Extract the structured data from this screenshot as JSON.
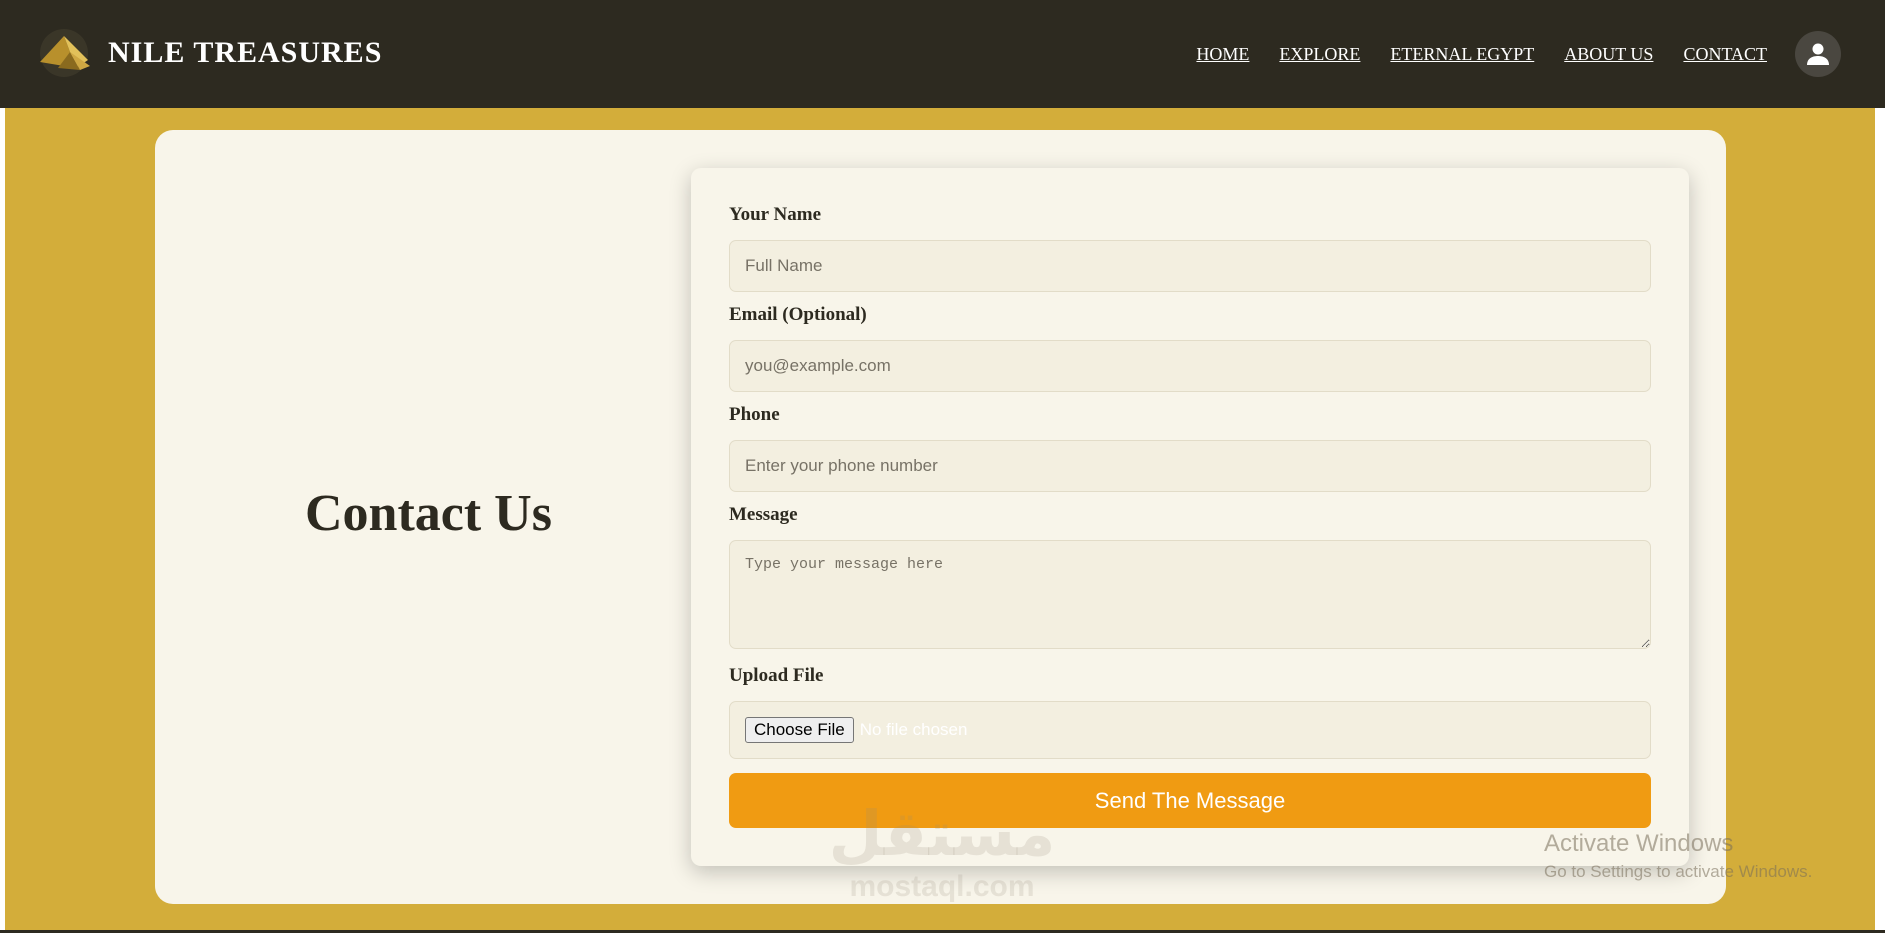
{
  "brand": {
    "title": "NILE TREASURES",
    "logo_icon": "pyramid-logo-icon"
  },
  "nav": {
    "links": [
      "HOME",
      "EXPLORE",
      "ETERNAL EGYPT",
      "ABOUT US",
      "CONTACT"
    ],
    "user_icon": "user-icon"
  },
  "page": {
    "heading": "Contact Us"
  },
  "form": {
    "name_label": "Your Name",
    "name_placeholder": "Full Name",
    "email_label": "Email (Optional)",
    "email_placeholder": "you@example.com",
    "phone_label": "Phone",
    "phone_placeholder": "Enter your phone number",
    "message_label": "Message",
    "message_placeholder": "Type your message here",
    "file_label": "Upload File",
    "file_button": "Choose File",
    "file_status": "No file chosen",
    "submit_label": "Send The Message"
  },
  "watermark": {
    "mark": "مستقل",
    "domain": "mostaql.com"
  },
  "os_notice": {
    "title": "Activate Windows",
    "subtitle": "Go to Settings to activate Windows."
  },
  "colors": {
    "navbar": "#2d2a20",
    "gold_background": "#d3ad3a",
    "card": "#f8f5ea",
    "field": "#f3efe0",
    "accent_button": "#f09b12"
  }
}
